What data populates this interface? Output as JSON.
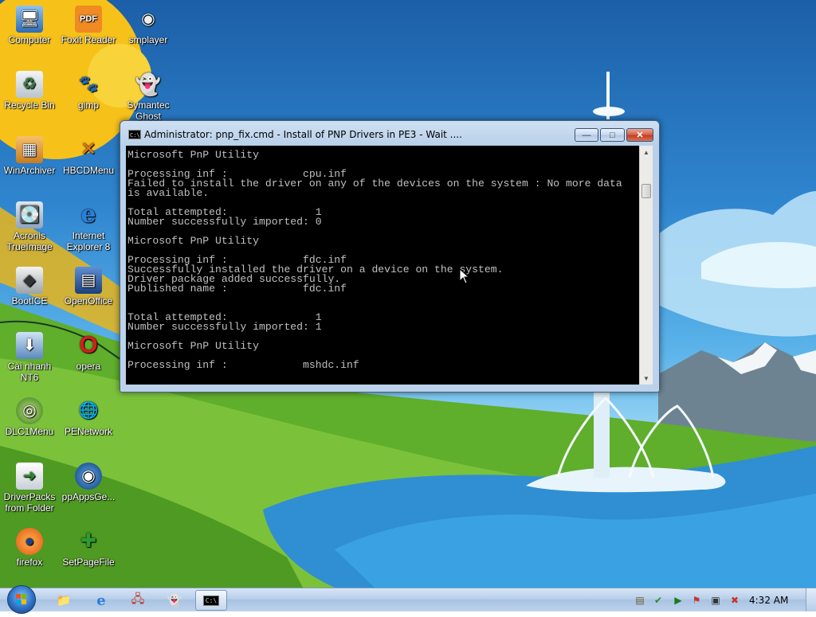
{
  "desktop_icons": [
    {
      "label": "Computer",
      "icon": "computer-icon"
    },
    {
      "label": "Foxit Reader",
      "icon": "pdf-icon"
    },
    {
      "label": "smplayer",
      "icon": "smplayer-icon"
    },
    {
      "label": "Recycle Bin",
      "icon": "recycle-bin-icon"
    },
    {
      "label": "gimp",
      "icon": "gimp-icon"
    },
    {
      "label": "Symantec Ghost",
      "icon": "ghost-icon"
    },
    {
      "label": "WinArchiver",
      "icon": "archive-icon"
    },
    {
      "label": "HBCDMenu",
      "icon": "tools-icon"
    },
    {
      "label": "Acronis TrueImage",
      "icon": "acronis-icon"
    },
    {
      "label": "Internet Explorer 8",
      "icon": "ie-icon"
    },
    {
      "label": "BootICE",
      "icon": "bootice-icon"
    },
    {
      "label": "OpenOffice",
      "icon": "openoffice-icon"
    },
    {
      "label": "Cài nhanh NT6",
      "icon": "install-icon"
    },
    {
      "label": "opera",
      "icon": "opera-icon"
    },
    {
      "label": "DLC1Menu",
      "icon": "dlc-icon"
    },
    {
      "label": "PENetwork",
      "icon": "network-icon"
    },
    {
      "label": "DriverPacks from Folder",
      "icon": "driverpacks-icon"
    },
    {
      "label": "ppAppsGe...",
      "icon": "ppapps-icon"
    },
    {
      "label": "firefox",
      "icon": "firefox-icon"
    },
    {
      "label": "SetPageFile",
      "icon": "setpagefile-icon"
    }
  ],
  "cmd_window": {
    "title": "Administrator:  pnp_fix.cmd - Install of PNP Drivers in PE3 - Wait ....",
    "icon_text": "C:\\.",
    "minimize_label": "—",
    "maximize_label": "□",
    "close_label": "✕",
    "console_lines": [
      "Microsoft PnP Utility",
      "",
      "Processing inf :            cpu.inf",
      "Failed to install the driver on any of the devices on the system : No more data",
      "is available.",
      "",
      "Total attempted:              1",
      "Number successfully imported: 0",
      "",
      "Microsoft PnP Utility",
      "",
      "Processing inf :            fdc.inf",
      "Successfully installed the driver on a device on the system.",
      "Driver package added successfully.",
      "Published name :            fdc.inf",
      "",
      "",
      "Total attempted:              1",
      "Number successfully imported: 1",
      "",
      "Microsoft PnP Utility",
      "",
      "Processing inf :            mshdc.inf"
    ]
  },
  "taskbar": {
    "pinned": [
      {
        "name": "explorer-taskbar-icon",
        "glyph": "📁"
      },
      {
        "name": "ie-taskbar-icon",
        "glyph": "e"
      },
      {
        "name": "network-taskbar-icon",
        "glyph": "🖧"
      },
      {
        "name": "ghost-taskbar-icon",
        "glyph": "👻"
      },
      {
        "name": "cmd-taskbar-icon",
        "glyph": "C:\\"
      }
    ],
    "clock": "4:32 AM"
  }
}
